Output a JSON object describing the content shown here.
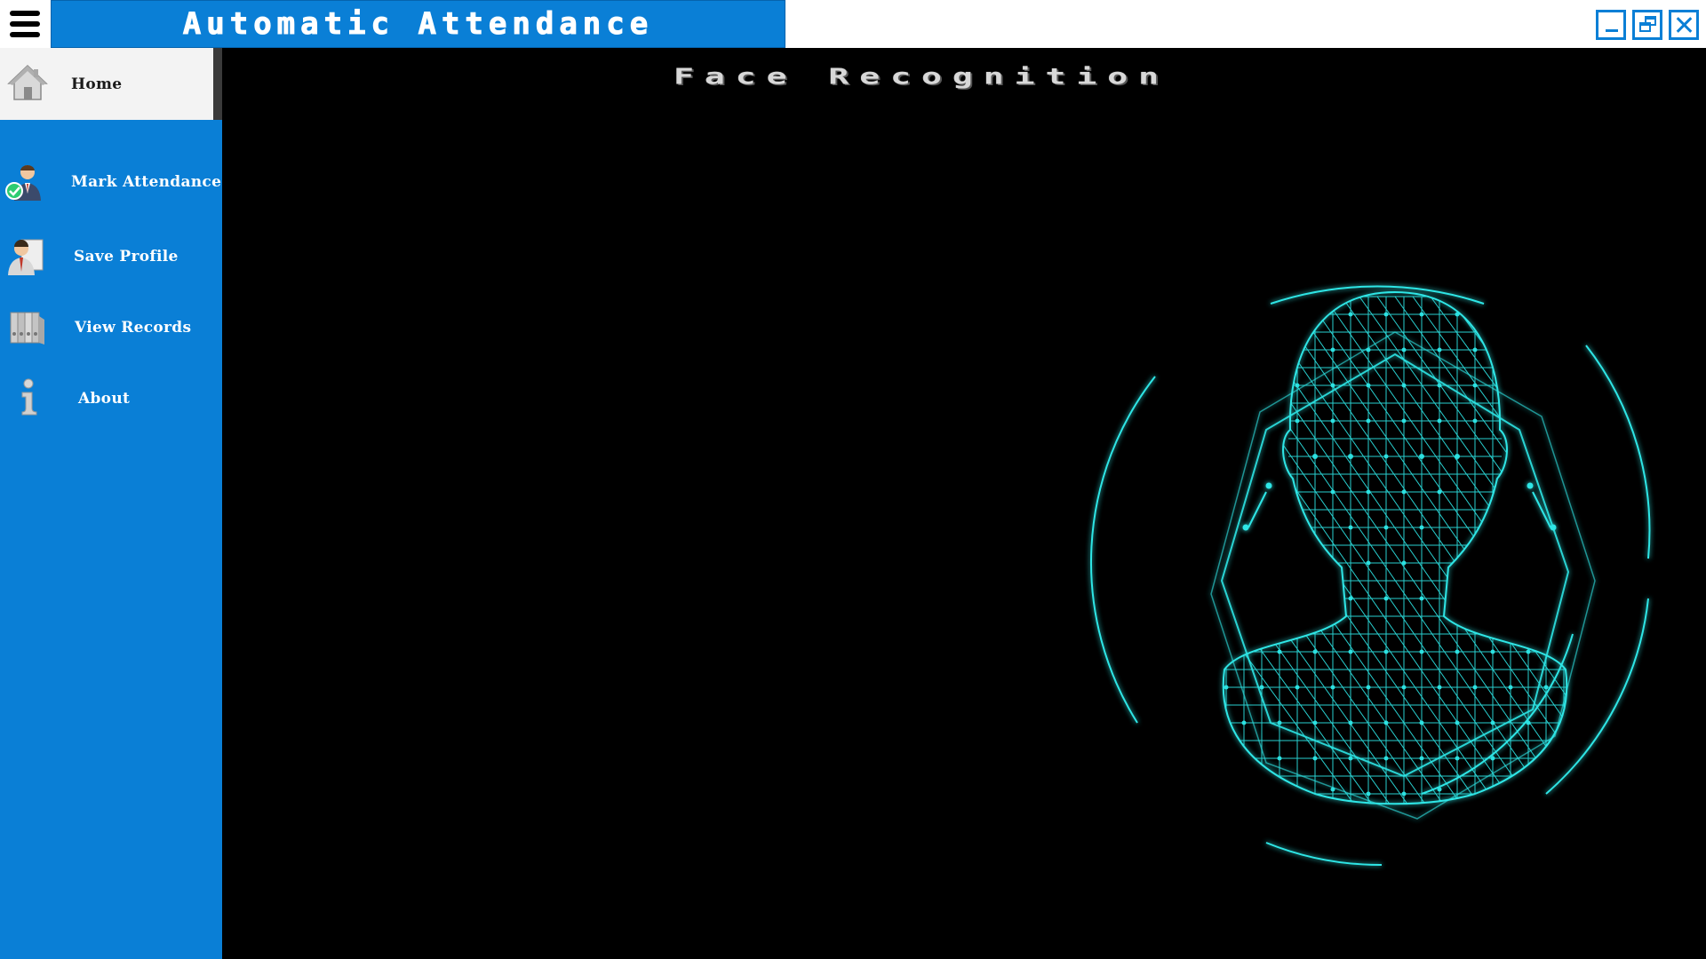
{
  "app": {
    "title": "Automatic Attendance"
  },
  "window_controls": {
    "minimize_icon": "minimize-icon",
    "restore_icon": "restore-icon",
    "close_icon": "close-icon"
  },
  "sidebar": {
    "menu_icon": "hamburger-menu-icon",
    "items": [
      {
        "label": "Home",
        "icon": "home-icon",
        "active": true
      },
      {
        "label": "Mark Attendance",
        "icon": "user-check-icon",
        "active": false
      },
      {
        "label": "Save Profile",
        "icon": "profile-icon",
        "active": false
      },
      {
        "label": "View Records",
        "icon": "binders-icon",
        "active": false
      },
      {
        "label": "About",
        "icon": "info-icon",
        "active": false
      }
    ]
  },
  "main": {
    "title": "Face Recognition",
    "graphic": "wireframe-face-scan"
  },
  "colors": {
    "accent": "#0a7fd6",
    "background": "#000000",
    "scan": "#2ee6e6"
  }
}
